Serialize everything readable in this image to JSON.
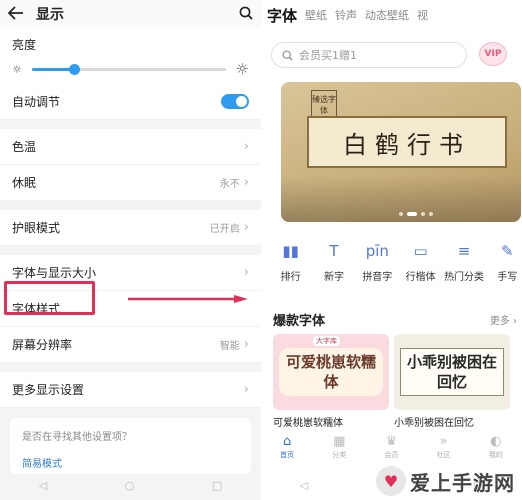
{
  "left": {
    "title": "显示",
    "brightness_label": "亮度",
    "brightness_level": 0.22,
    "auto_adjust": {
      "label": "自动调节",
      "on": true
    },
    "rows_a": [
      {
        "label": "色温",
        "value": ""
      },
      {
        "label": "休眠",
        "value": "永不"
      }
    ],
    "eye": {
      "label": "护眼模式",
      "value": "已开启"
    },
    "rows_b": [
      {
        "label": "字体与显示大小",
        "value": ""
      },
      {
        "label": "字体样式",
        "value": ""
      },
      {
        "label": "屏幕分辨率",
        "value": "智能"
      }
    ],
    "more": {
      "label": "更多显示设置"
    },
    "hint": {
      "question": "是否在寻找其他设置项？",
      "link": "简易模式"
    },
    "accent": "#2f9cf0",
    "highlight_color": "#e0305a"
  },
  "right": {
    "tabs": [
      "字体",
      "壁纸",
      "铃声",
      "动态壁纸",
      "视"
    ],
    "search_placeholder": "会员买1赠1",
    "vip": "VIP",
    "banner": {
      "stamp": "臻选字体",
      "title": "白鹤行书"
    },
    "categories": [
      {
        "icon": "bar-chart-icon",
        "glyph": "▮▮",
        "label": "排行"
      },
      {
        "icon": "new-font-icon",
        "glyph": "T",
        "label": "新字"
      },
      {
        "icon": "pinyin-icon",
        "glyph": "pīn",
        "label": "拼音字"
      },
      {
        "icon": "book-icon",
        "glyph": "▭",
        "label": "行楷体"
      },
      {
        "icon": "list-icon",
        "glyph": "≡",
        "label": "热门分类"
      },
      {
        "icon": "handwrite-icon",
        "glyph": "✎",
        "label": "手写"
      }
    ],
    "section_title": "爆款字体",
    "section_more": "更多",
    "fonts": [
      {
        "preview": "可爱桃崽软糯体",
        "tag": "大字库",
        "caption": "可爱桃崽软糯体"
      },
      {
        "preview": "小乖别被困在回忆",
        "tag": "",
        "caption": "小乖别被困在回忆"
      }
    ],
    "bottom_nav": [
      {
        "icon": "home-icon",
        "label": "首页",
        "active": true
      },
      {
        "icon": "category-icon",
        "label": "分类",
        "active": false
      },
      {
        "icon": "member-icon",
        "label": "会员",
        "active": false
      },
      {
        "icon": "discover-icon",
        "label": "社区",
        "active": false
      },
      {
        "icon": "profile-icon",
        "label": "我的",
        "active": false
      }
    ]
  },
  "watermark": "爱上手游网"
}
